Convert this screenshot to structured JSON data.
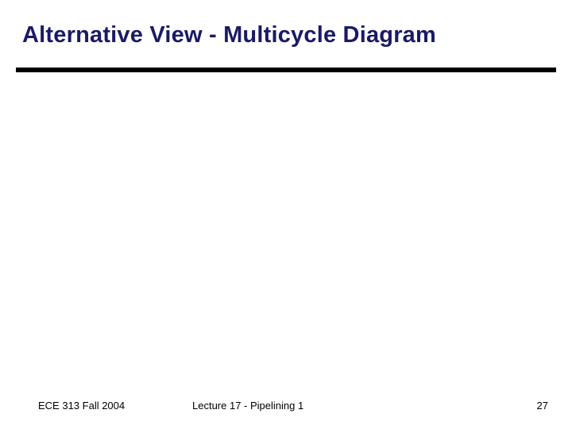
{
  "slide": {
    "title": "Alternative View - Multicycle Diagram",
    "footer": {
      "left": "ECE 313 Fall 2004",
      "center": "Lecture 17 - Pipelining 1",
      "page": "27"
    }
  }
}
